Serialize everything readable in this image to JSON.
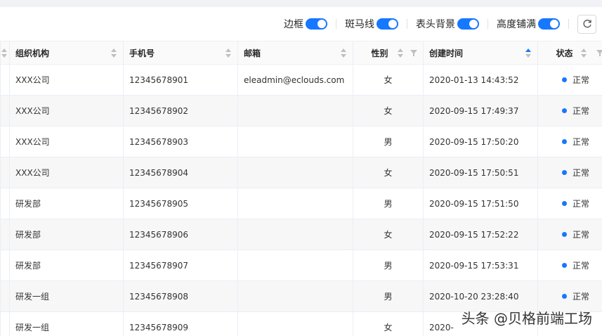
{
  "toolbar": {
    "switches": [
      {
        "label": "边框",
        "on": true
      },
      {
        "label": "斑马线",
        "on": true
      },
      {
        "label": "表头背景",
        "on": true
      },
      {
        "label": "高度铺满",
        "on": true
      }
    ]
  },
  "table": {
    "columns": [
      "组织机构",
      "手机号",
      "邮箱",
      "性别",
      "创建时间",
      "状态"
    ],
    "rows": [
      {
        "org": "XXX公司",
        "phone": "12345678901",
        "email": "eleadmin@eclouds.com",
        "gender": "女",
        "created": "2020-01-13 14:43:52",
        "status": "正常"
      },
      {
        "org": "XXX公司",
        "phone": "12345678902",
        "email": "",
        "gender": "女",
        "created": "2020-09-15 17:49:37",
        "status": "正常"
      },
      {
        "org": "XXX公司",
        "phone": "12345678903",
        "email": "",
        "gender": "男",
        "created": "2020-09-15 17:50:20",
        "status": "正常"
      },
      {
        "org": "XXX公司",
        "phone": "12345678904",
        "email": "",
        "gender": "女",
        "created": "2020-09-15 17:50:51",
        "status": "正常"
      },
      {
        "org": "研发部",
        "phone": "12345678905",
        "email": "",
        "gender": "男",
        "created": "2020-09-15 17:51:50",
        "status": "正常"
      },
      {
        "org": "研发部",
        "phone": "12345678906",
        "email": "",
        "gender": "女",
        "created": "2020-09-15 17:52:22",
        "status": "正常"
      },
      {
        "org": "研发部",
        "phone": "12345678907",
        "email": "",
        "gender": "男",
        "created": "2020-09-15 17:53:31",
        "status": "正常"
      },
      {
        "org": "研发一组",
        "phone": "12345678908",
        "email": "",
        "gender": "男",
        "created": "2020-10-20 23:28:40",
        "status": "正常"
      },
      {
        "org": "研发一组",
        "phone": "12345678909",
        "email": "",
        "gender": "女",
        "created": "2020-",
        "status": ""
      }
    ]
  },
  "watermark": "头条 @贝格前端工场",
  "colors": {
    "accent": "#1677ff",
    "stripe": "#f7f7f7",
    "header_bg": "#fafafa",
    "border": "#ebeef5"
  }
}
